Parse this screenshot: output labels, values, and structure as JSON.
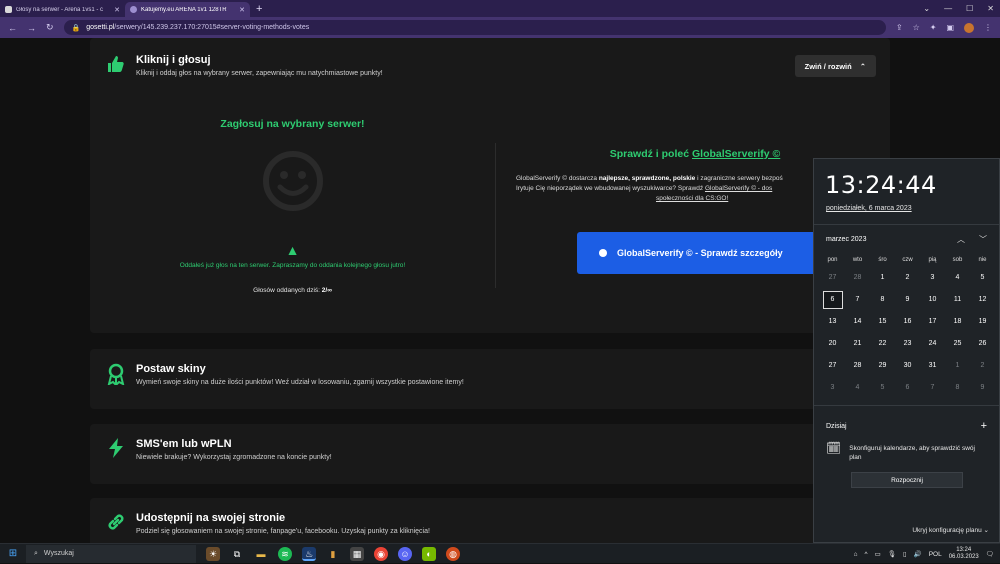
{
  "browser": {
    "tabs": [
      {
        "title": "Głosy na serwer - Arena 1vs1 - c",
        "active": false
      },
      {
        "title": "Katujemy.eu ARENA 1v1 128TR",
        "active": true
      }
    ],
    "new_tab": "+",
    "url_host": "gosetti.pl",
    "url_path": "/serwery/145.239.237.170:27015#server-voting-methods-votes"
  },
  "vote_card": {
    "title": "Kliknij i głosuj",
    "subtitle": "Kliknij i oddaj głos na wybrany serwer, zapewniając mu natychmiastowe punkty!",
    "toggle_label": "Zwiń / rozwiń",
    "left": {
      "heading": "Zagłosuj na wybrany serwer!",
      "voted_message": "Oddałeś już głos na ten serwer. Zapraszamy do oddania kolejnego głosu jutro!",
      "votes_today_label": "Głosów oddanych dziś:",
      "votes_today_value": "2/∞"
    },
    "right": {
      "heading_prefix": "Sprawdź i poleć",
      "heading_link": "GlobalServerify ©",
      "text_1": "GlobalServerify © dostarcza",
      "text_bold": "najlepsze, sprawdzone, polskie",
      "text_2": "i zagraniczne serwery bezpoś",
      "text_3": "Irytuje Cię nieporządek we wbudowanej wyszukiwarce? Sprawdź",
      "text_link": "GlobalServerify © - dos",
      "text_link2": "społeczności dla CS:GO!",
      "button_label": "GlobalServerify © - Sprawdź szczegóły"
    }
  },
  "cards": [
    {
      "title": "Postaw skiny",
      "subtitle": "Wymień swoje skiny na duże ilości punktów! Weź udział w losowaniu, zgarnij wszystkie postawione itemy!",
      "icon": "award-icon"
    },
    {
      "title": "SMS'em lub wPLN",
      "subtitle": "Niewiele brakuje? Wykorzystaj zgromadzone na koncie punkty!",
      "icon": "bolt-icon"
    },
    {
      "title": "Udostępnij na swojej stronie",
      "subtitle": "Podziel się głosowaniem na swojej stronie, fanpage'u, facebooku. Uzyskaj punkty za kliknięcia!",
      "icon": "link-icon"
    }
  ],
  "calendar": {
    "time": "13:24:44",
    "date": "poniedziałek, 6 marca 2023",
    "month": "marzec 2023",
    "weekdays": [
      "pon",
      "wto",
      "śro",
      "czw",
      "pią",
      "sob",
      "nie"
    ],
    "days": [
      [
        "27",
        "28",
        "1",
        "2",
        "3",
        "4",
        "5"
      ],
      [
        "6",
        "7",
        "8",
        "9",
        "10",
        "11",
        "12"
      ],
      [
        "13",
        "14",
        "15",
        "16",
        "17",
        "18",
        "19"
      ],
      [
        "20",
        "21",
        "22",
        "23",
        "24",
        "25",
        "26"
      ],
      [
        "27",
        "28",
        "29",
        "30",
        "31",
        "1",
        "2"
      ],
      [
        "3",
        "4",
        "5",
        "6",
        "7",
        "8",
        "9"
      ]
    ],
    "today_label": "Dzisiaj",
    "configure_text": "Skonfiguruj kalendarze, aby sprawdzić swój plan",
    "start_button": "Rozpocznij",
    "hide_plan": "Ukryj konfigurację planu"
  },
  "taskbar": {
    "search_placeholder": "Wyszukaj",
    "language": "POL",
    "time": "13:24",
    "date": "06.03.2023"
  },
  "colors": {
    "accent_green": "#2ecc71",
    "button_blue": "#1c5ee5",
    "browser_purple": "#44336f"
  }
}
